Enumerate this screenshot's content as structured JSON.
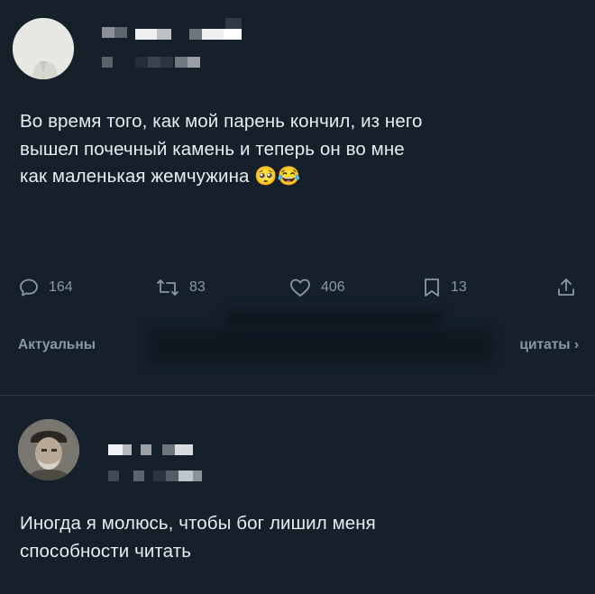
{
  "post": {
    "text": "Во время того, как мой парень кончил, из него\nвышел почечный камень и теперь он во мне\nкак маленькая жемчужина 🥺😂",
    "actions": {
      "replies": "164",
      "reposts": "83",
      "likes": "406",
      "bookmarks": "13"
    },
    "icons": {
      "reply": "reply-icon",
      "repost": "repost-icon",
      "like": "heart-icon",
      "bookmark": "bookmark-icon",
      "share": "share-icon"
    },
    "quote_bar": {
      "left_label": "Актуальны",
      "right_label": "цитаты ›"
    }
  },
  "reply": {
    "text": "Иногда я молюсь, чтобы бог лишил меня\nспособности читать"
  },
  "colors": {
    "background": "#15202b",
    "text": "#e7e9ea",
    "muted": "#8b98a5"
  }
}
